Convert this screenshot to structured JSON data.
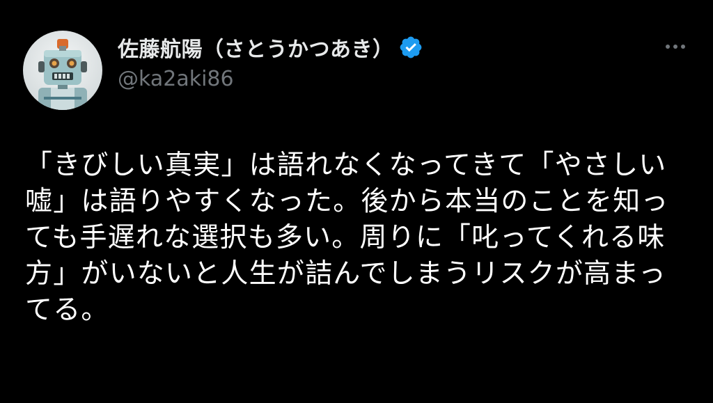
{
  "author": {
    "display_name": "佐藤航陽（さとうかつあき）",
    "handle": "@ka2aki86",
    "avatar_icon": "robot-avatar",
    "verified_icon": "verified-badge-icon",
    "verified_color": "#1d9bf0"
  },
  "menu": {
    "icon": "more-options-icon"
  },
  "tweet": {
    "lines": [
      "「きびしい真実」は語れなくなってきて「やさしい",
      "嘘」は語りやすくなった。後から本当のことを知っ",
      "ても手遅れな選択も多い。周りに「叱ってくれる味",
      "方」がいないと人生が詰んでしまうリスクが高まっ",
      "てる。"
    ]
  },
  "colors": {
    "background": "#000000",
    "primary_text": "#e7e9ea",
    "secondary_text": "#71767b",
    "accent": "#1d9bf0"
  }
}
